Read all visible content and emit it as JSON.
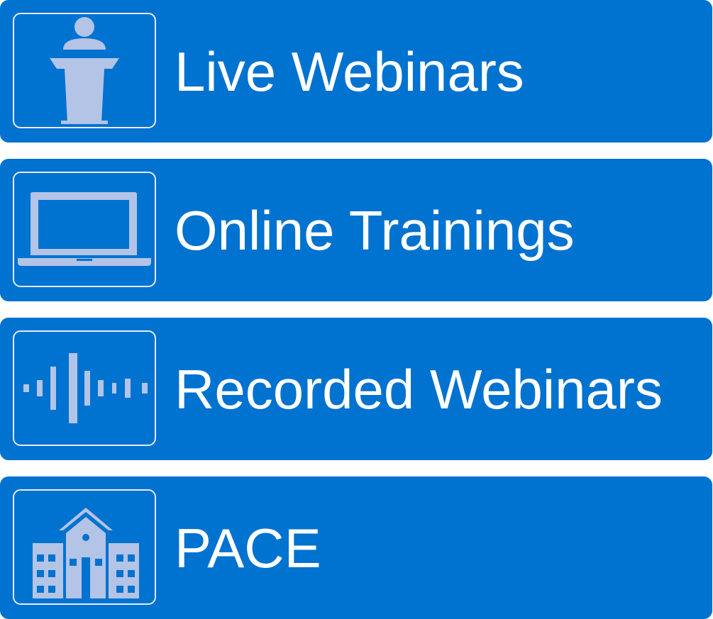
{
  "menu": {
    "items": [
      {
        "label": "Live Webinars",
        "icon": "podium-speaker-icon"
      },
      {
        "label": "Online Trainings",
        "icon": "laptop-icon"
      },
      {
        "label": "Recorded Webinars",
        "icon": "audio-waveform-icon"
      },
      {
        "label": "PACE",
        "icon": "school-building-icon"
      }
    ]
  },
  "colors": {
    "button_background": "#0072d0",
    "icon_fill": "#b3c4e6",
    "icon_frame_border": "#e6ecf8",
    "label_text": "#ffffff"
  }
}
